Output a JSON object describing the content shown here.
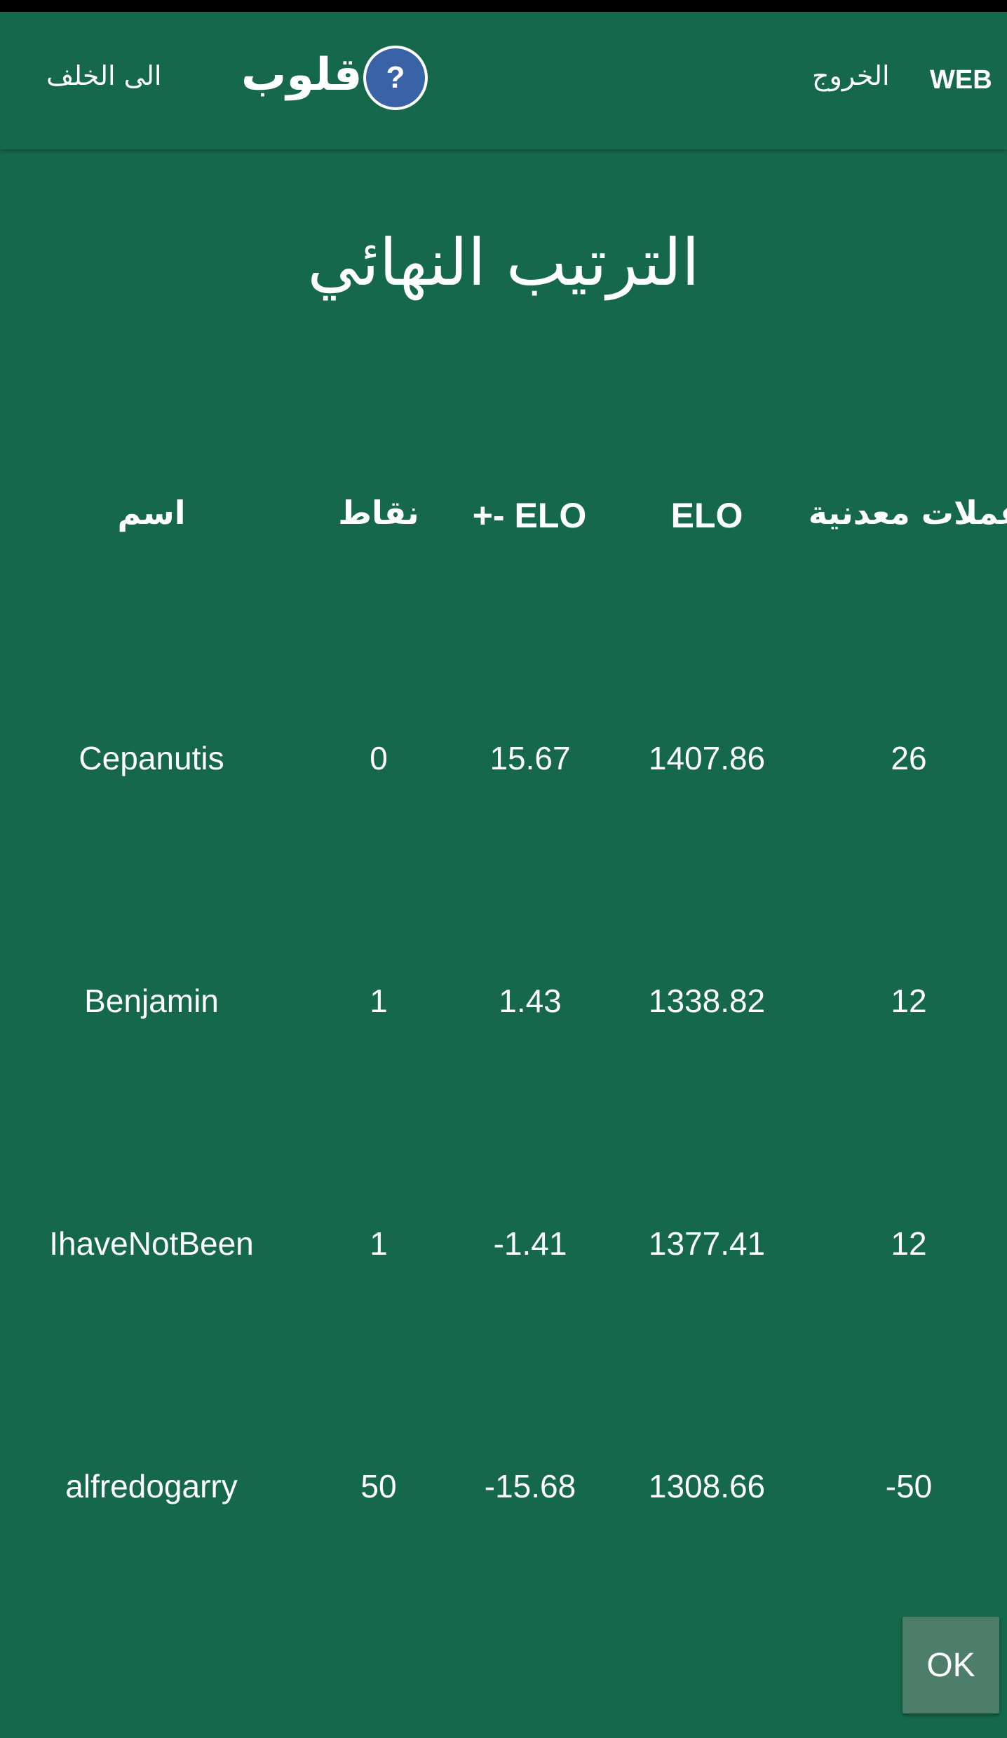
{
  "topbar": {
    "back_label": "الى الخلف",
    "app_title": "قلوب",
    "help_label": "?",
    "exit_label": "الخروج",
    "web_label": "WEB"
  },
  "page_title": "الترتيب النهائي",
  "table": {
    "headers": {
      "name": "اسم",
      "points": "نقاط",
      "elo_delta": "+- ELO",
      "elo": "ELO",
      "coins": "عملات معدنية"
    },
    "rows": [
      {
        "name": "Cepanutis",
        "points": "0",
        "elo_delta": "15.67",
        "elo": "1407.86",
        "coins": "26"
      },
      {
        "name": "Benjamin",
        "points": "1",
        "elo_delta": "1.43",
        "elo": "1338.82",
        "coins": "12"
      },
      {
        "name": "IhaveNotBeen",
        "points": "1",
        "elo_delta": "-1.41",
        "elo": "1377.41",
        "coins": "12"
      },
      {
        "name": "alfredogarry",
        "points": "50",
        "elo_delta": "-15.68",
        "elo": "1308.66",
        "coins": "-50"
      }
    ]
  },
  "ok_label": "OK",
  "colors": {
    "background": "#16684c",
    "help_button": "#3a62a6",
    "ok_button": "#4d7e6c"
  }
}
